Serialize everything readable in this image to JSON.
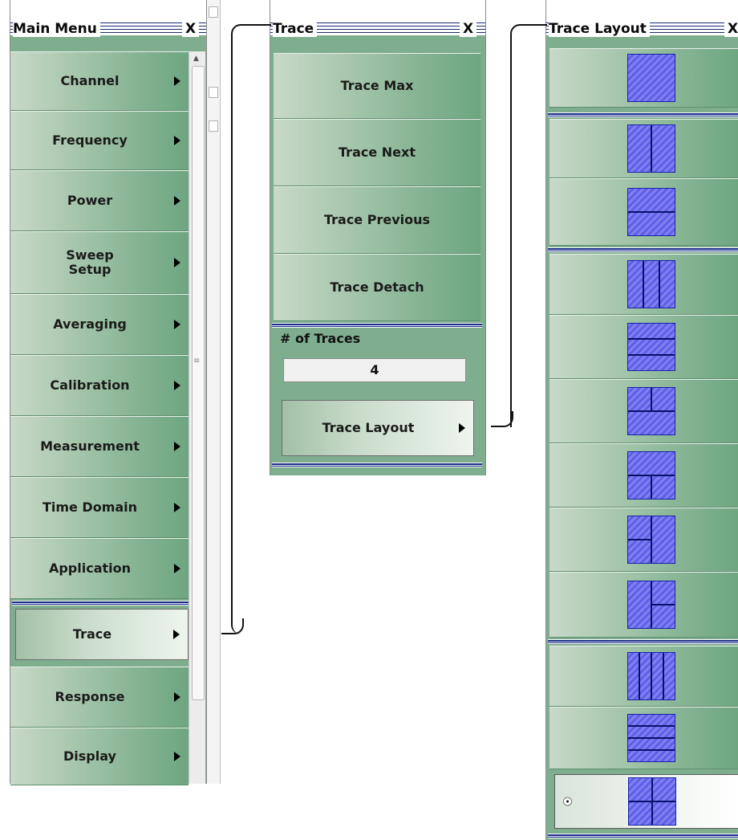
{
  "main_menu": {
    "title": "Main Menu",
    "close": "X",
    "items": [
      {
        "label": "Channel"
      },
      {
        "label": "Frequency"
      },
      {
        "label": "Power"
      },
      {
        "label": "Sweep\nSetup"
      },
      {
        "label": "Averaging"
      },
      {
        "label": "Calibration"
      },
      {
        "label": "Measurement"
      },
      {
        "label": "Time Domain"
      },
      {
        "label": "Application"
      },
      {
        "label": "Trace"
      },
      {
        "label": "Response"
      },
      {
        "label": "Display"
      }
    ]
  },
  "trace_menu": {
    "title": "Trace",
    "close": "X",
    "items": [
      {
        "label": "Trace Max"
      },
      {
        "label": "Trace Next"
      },
      {
        "label": "Trace Previous"
      },
      {
        "label": "Trace Detach"
      }
    ],
    "num_traces_label": "# of Traces",
    "num_traces_value": "4",
    "layout_button": "Trace Layout"
  },
  "layout_menu": {
    "title": "Trace Layout",
    "close": "X",
    "options": [
      {
        "icon": "layout-1-single-icon"
      },
      {
        "icon": "layout-2-side-by-side-icon"
      },
      {
        "icon": "layout-2-stacked-icon"
      },
      {
        "icon": "layout-3-columns-icon"
      },
      {
        "icon": "layout-3-rows-icon"
      },
      {
        "icon": "layout-3-two-top-one-bottom-icon"
      },
      {
        "icon": "layout-3-one-top-two-bottom-icon"
      },
      {
        "icon": "layout-3-two-left-one-right-icon"
      },
      {
        "icon": "layout-3-one-left-two-right-icon"
      },
      {
        "icon": "layout-4-columns-icon"
      },
      {
        "icon": "layout-4-rows-icon"
      },
      {
        "icon": "layout-4-grid-icon",
        "selected": true
      }
    ]
  }
}
